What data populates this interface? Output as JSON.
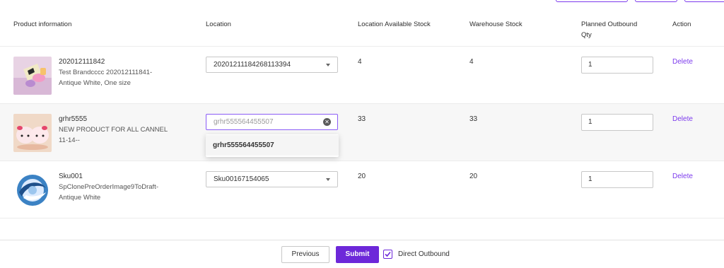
{
  "table": {
    "headers": {
      "product": "Product information",
      "location": "Location",
      "location_stock": "Location Available Stock",
      "warehouse_stock": "Warehouse Stock",
      "planned_qty_line1": "Planned Outbound",
      "planned_qty_line2": "Qty",
      "action": "Action"
    },
    "rows": [
      {
        "sku": "202012111842",
        "name_line1": "Test Brandcccc 202012111841-",
        "name_line2": "Antique White, One size",
        "location": "20201211184268113394",
        "location_stock": "4",
        "warehouse_stock": "4",
        "qty": "1",
        "action": "Delete",
        "thumb_icon": "product-photo-pink-items"
      },
      {
        "sku": "grhr5555",
        "name_line1": "NEW PRODUCT FOR ALL CANNEL",
        "name_line2": "11-14--",
        "location": "grhr555564455507",
        "location_stock": "33",
        "warehouse_stock": "33",
        "qty": "1",
        "action": "Delete",
        "thumb_icon": "product-photo-hello-kitty"
      },
      {
        "sku": "Sku001",
        "name_line1": "SpClonePreOrderImage9ToDraft-",
        "name_line2": "Antique White",
        "location": "Sku00167154065",
        "location_stock": "20",
        "warehouse_stock": "20",
        "qty": "1",
        "action": "Delete",
        "thumb_icon": "product-photo-blue-swirl"
      }
    ]
  },
  "dropdown": {
    "option": "grhr555564455507"
  },
  "footer": {
    "previous_label": "Previous",
    "submit_label": "Submit",
    "direct_outbound_label": "Direct Outbound",
    "direct_outbound_checked": true
  },
  "colors": {
    "accent": "#6d28d9",
    "link": "#7c3aed"
  }
}
